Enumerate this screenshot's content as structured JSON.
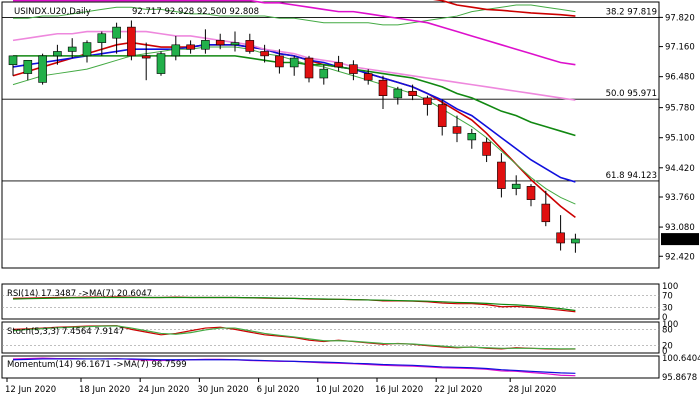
{
  "symbol_header": "USINDX.U20,Daily",
  "ohlc_header": "92.717 92.928 92.500 92.808",
  "colors": {
    "bull": "#22b04a",
    "bear": "#e01010",
    "wick": "#000000",
    "ma_red": "#cc0000",
    "ma_blue": "#1010dd",
    "ma_green": "#118811",
    "ma_thin_green": "#44aa44",
    "ma_magenta": "#dd10cc",
    "ma_pink": "#ee88dd",
    "fib_line": "#000000",
    "price_badge_bg": "#000000",
    "price_badge_fg": "#ffffff"
  },
  "chart_data": [
    {
      "type": "candlestick",
      "title": "USINDX.U20,Daily",
      "ylim": [
        92.2,
        98.1
      ],
      "price_ticks": [
        "97.820",
        "97.160",
        "96.480",
        "95.780",
        "95.100",
        "94.420",
        "93.760",
        "93.080",
        "92.420"
      ],
      "current_price": "92.808",
      "date_labels": [
        "12 Jun 2020",
        "18 Jun 2020",
        "24 Jun 2020",
        "30 Jun 2020",
        "6 Jul 2020",
        "10 Jul 2020",
        "16 Jul 2020",
        "22 Jul 2020",
        "28 Jul 2020"
      ],
      "fib_levels": [
        {
          "label": "38.2 97.819",
          "value": 97.819
        },
        {
          "label": "50.0 95.971",
          "value": 95.971
        },
        {
          "label": "61.8 94.123",
          "value": 94.123
        }
      ],
      "candles": [
        {
          "o": 96.75,
          "h": 96.95,
          "l": 96.5,
          "c": 96.95
        },
        {
          "o": 96.55,
          "h": 96.85,
          "l": 96.4,
          "c": 96.85
        },
        {
          "o": 96.35,
          "h": 97.0,
          "l": 96.3,
          "c": 96.95
        },
        {
          "o": 96.95,
          "h": 97.2,
          "l": 96.75,
          "c": 97.05
        },
        {
          "o": 97.05,
          "h": 97.35,
          "l": 96.9,
          "c": 97.15
        },
        {
          "o": 96.95,
          "h": 97.3,
          "l": 96.8,
          "c": 97.25
        },
        {
          "o": 97.25,
          "h": 97.5,
          "l": 96.95,
          "c": 97.45
        },
        {
          "o": 97.35,
          "h": 97.7,
          "l": 97.0,
          "c": 97.6
        },
        {
          "o": 97.6,
          "h": 97.75,
          "l": 96.85,
          "c": 96.95
        },
        {
          "o": 96.95,
          "h": 97.25,
          "l": 96.4,
          "c": 96.9
        },
        {
          "o": 96.55,
          "h": 97.05,
          "l": 96.5,
          "c": 97.0
        },
        {
          "o": 96.95,
          "h": 97.4,
          "l": 96.85,
          "c": 97.2
        },
        {
          "o": 97.2,
          "h": 97.3,
          "l": 97.0,
          "c": 97.1
        },
        {
          "o": 97.1,
          "h": 97.55,
          "l": 97.0,
          "c": 97.3
        },
        {
          "o": 97.3,
          "h": 97.45,
          "l": 97.1,
          "c": 97.2
        },
        {
          "o": 97.2,
          "h": 97.5,
          "l": 97.05,
          "c": 97.25
        },
        {
          "o": 97.3,
          "h": 97.45,
          "l": 97.0,
          "c": 97.05
        },
        {
          "o": 97.05,
          "h": 97.2,
          "l": 96.8,
          "c": 96.95
        },
        {
          "o": 96.95,
          "h": 97.1,
          "l": 96.55,
          "c": 96.7
        },
        {
          "o": 96.7,
          "h": 96.95,
          "l": 96.5,
          "c": 96.9
        },
        {
          "o": 96.9,
          "h": 96.95,
          "l": 96.35,
          "c": 96.45
        },
        {
          "o": 96.45,
          "h": 96.75,
          "l": 96.3,
          "c": 96.65
        },
        {
          "o": 96.8,
          "h": 96.95,
          "l": 96.6,
          "c": 96.7
        },
        {
          "o": 96.75,
          "h": 96.85,
          "l": 96.4,
          "c": 96.55
        },
        {
          "o": 96.55,
          "h": 96.65,
          "l": 96.3,
          "c": 96.4
        },
        {
          "o": 96.4,
          "h": 96.5,
          "l": 95.75,
          "c": 96.05
        },
        {
          "o": 96.0,
          "h": 96.25,
          "l": 95.85,
          "c": 96.2
        },
        {
          "o": 96.15,
          "h": 96.3,
          "l": 95.95,
          "c": 96.05
        },
        {
          "o": 96.0,
          "h": 96.05,
          "l": 95.6,
          "c": 95.85
        },
        {
          "o": 95.85,
          "h": 95.95,
          "l": 95.15,
          "c": 95.35
        },
        {
          "o": 95.35,
          "h": 95.6,
          "l": 95.0,
          "c": 95.2
        },
        {
          "o": 95.05,
          "h": 95.3,
          "l": 94.85,
          "c": 95.2
        },
        {
          "o": 95.0,
          "h": 95.1,
          "l": 94.55,
          "c": 94.7
        },
        {
          "o": 94.55,
          "h": 94.75,
          "l": 93.75,
          "c": 93.95
        },
        {
          "o": 93.95,
          "h": 94.25,
          "l": 93.8,
          "c": 94.05
        },
        {
          "o": 94.0,
          "h": 94.05,
          "l": 93.55,
          "c": 93.7
        },
        {
          "o": 93.6,
          "h": 93.9,
          "l": 93.1,
          "c": 93.2
        },
        {
          "o": 92.95,
          "h": 93.35,
          "l": 92.55,
          "c": 92.72
        },
        {
          "o": 92.72,
          "h": 92.93,
          "l": 92.5,
          "c": 92.81
        }
      ],
      "moving_averages": [
        {
          "color_key": "ma_red",
          "values": [
            96.5,
            96.6,
            96.7,
            96.8,
            96.9,
            97.0,
            97.1,
            97.2,
            97.25,
            97.2,
            97.15,
            97.15,
            97.15,
            97.2,
            97.2,
            97.2,
            97.15,
            97.1,
            97.0,
            96.95,
            96.85,
            96.75,
            96.7,
            96.65,
            96.55,
            96.45,
            96.35,
            96.25,
            96.1,
            95.9,
            95.7,
            95.5,
            95.2,
            94.85,
            94.5,
            94.15,
            93.85,
            93.55,
            93.3
          ]
        },
        {
          "color_key": "ma_blue",
          "values": [
            96.7,
            96.75,
            96.8,
            96.85,
            96.9,
            96.95,
            97.0,
            97.05,
            97.1,
            97.1,
            97.1,
            97.1,
            97.15,
            97.2,
            97.2,
            97.2,
            97.15,
            97.1,
            97.0,
            96.95,
            96.85,
            96.8,
            96.7,
            96.65,
            96.55,
            96.45,
            96.35,
            96.25,
            96.1,
            95.95,
            95.75,
            95.6,
            95.35,
            95.1,
            94.85,
            94.6,
            94.4,
            94.2,
            94.1
          ]
        },
        {
          "color_key": "ma_green",
          "values": [
            96.95,
            96.95,
            96.95,
            96.95,
            96.95,
            96.95,
            96.95,
            96.95,
            96.95,
            96.95,
            96.95,
            96.95,
            96.95,
            96.95,
            96.95,
            96.95,
            96.9,
            96.85,
            96.8,
            96.8,
            96.75,
            96.75,
            96.7,
            96.65,
            96.6,
            96.55,
            96.5,
            96.45,
            96.35,
            96.25,
            96.1,
            96.0,
            95.85,
            95.7,
            95.6,
            95.45,
            95.35,
            95.25,
            95.15
          ]
        },
        {
          "color_key": "ma_thin_green",
          "values": [
            96.3,
            96.4,
            96.5,
            96.55,
            96.6,
            96.65,
            96.75,
            96.85,
            96.95,
            97.0,
            97.05,
            97.1,
            97.1,
            97.15,
            97.15,
            97.15,
            97.1,
            97.0,
            96.95,
            96.85,
            96.75,
            96.7,
            96.6,
            96.5,
            96.4,
            96.3,
            96.2,
            96.1,
            95.95,
            95.75,
            95.55,
            95.35,
            95.1,
            94.8,
            94.5,
            94.2,
            93.95,
            93.75,
            93.6
          ]
        },
        {
          "color_key": "ma_thin_green",
          "values": [
            97.8,
            97.8,
            97.85,
            97.85,
            97.9,
            97.95,
            98.0,
            98.05,
            98.05,
            98.0,
            98.0,
            97.95,
            97.9,
            97.9,
            97.85,
            97.85,
            97.85,
            97.85,
            97.8,
            97.8,
            97.75,
            97.7,
            97.7,
            97.7,
            97.7,
            97.65,
            97.65,
            97.7,
            97.75,
            97.8,
            97.85,
            97.95,
            98.0,
            98.05,
            98.1,
            98.1,
            98.05,
            98.0,
            97.95
          ]
        },
        {
          "color_key": "ma_magenta",
          "values": [
            98.2,
            98.2,
            98.2,
            98.2,
            98.2,
            98.2,
            98.2,
            98.2,
            98.2,
            98.2,
            98.2,
            98.2,
            98.2,
            98.2,
            98.2,
            98.2,
            98.2,
            98.15,
            98.15,
            98.1,
            98.05,
            98.0,
            97.95,
            97.95,
            97.9,
            97.85,
            97.8,
            97.75,
            97.7,
            97.6,
            97.5,
            97.4,
            97.3,
            97.2,
            97.1,
            97.0,
            96.9,
            96.8,
            96.75
          ]
        },
        {
          "color_key": "ma_pink",
          "values": [
            97.3,
            97.35,
            97.4,
            97.45,
            97.45,
            97.5,
            97.5,
            97.5,
            97.5,
            97.5,
            97.45,
            97.4,
            97.4,
            97.35,
            97.3,
            97.25,
            97.2,
            97.1,
            97.05,
            97.0,
            96.9,
            96.85,
            96.8,
            96.7,
            96.65,
            96.6,
            96.55,
            96.5,
            96.45,
            96.4,
            96.35,
            96.3,
            96.25,
            96.2,
            96.15,
            96.1,
            96.05,
            96.0,
            95.95
          ]
        },
        {
          "color_key": "ma_red",
          "values": [
            98.3,
            98.3,
            98.3,
            98.3,
            98.3,
            98.3,
            98.3,
            98.3,
            98.3,
            98.3,
            98.3,
            98.3,
            98.3,
            98.3,
            98.3,
            98.3,
            98.3,
            98.3,
            98.3,
            98.3,
            98.3,
            98.3,
            98.3,
            98.3,
            98.3,
            98.3,
            98.3,
            98.3,
            98.25,
            98.2,
            98.1,
            98.05,
            98.0,
            97.98,
            97.95,
            97.92,
            97.9,
            97.88,
            97.85
          ]
        }
      ]
    },
    {
      "type": "line",
      "title": "RSI(14) 17.3487 ->MA(7) 20.6047",
      "yticks": [
        "100",
        "70",
        "30",
        "0"
      ],
      "series": [
        {
          "color_key": "ma_red",
          "values": [
            60,
            61,
            62,
            63,
            63,
            64,
            64,
            65,
            64,
            63,
            63,
            64,
            63,
            63,
            63,
            63,
            62,
            61,
            60,
            60,
            58,
            57,
            57,
            56,
            55,
            52,
            52,
            51,
            49,
            45,
            43,
            43,
            40,
            33,
            34,
            31,
            27,
            22,
            17
          ]
        },
        {
          "color_key": "ma_green",
          "values": [
            58,
            59,
            60,
            61,
            62,
            62,
            63,
            63,
            63,
            63,
            63,
            63,
            63,
            63,
            63,
            63,
            62,
            62,
            61,
            60,
            59,
            58,
            57,
            56,
            55,
            54,
            53,
            52,
            51,
            49,
            47,
            46,
            44,
            41,
            39,
            36,
            32,
            27,
            21
          ]
        }
      ]
    },
    {
      "type": "line",
      "title": "Stoch(5,3,3) 7.4564 7.9147",
      "yticks": [
        "100",
        "80",
        "20",
        "0"
      ],
      "series": [
        {
          "color_key": "ma_red",
          "values": [
            80,
            82,
            85,
            88,
            90,
            92,
            93,
            94,
            80,
            70,
            60,
            65,
            75,
            85,
            88,
            80,
            70,
            60,
            55,
            50,
            40,
            35,
            40,
            35,
            30,
            25,
            28,
            25,
            20,
            15,
            12,
            15,
            10,
            8,
            12,
            10,
            8,
            7,
            7.5
          ]
        },
        {
          "color_key": "ma_thin_green",
          "values": [
            75,
            80,
            83,
            86,
            88,
            90,
            92,
            93,
            85,
            75,
            65,
            62,
            68,
            78,
            85,
            85,
            75,
            65,
            58,
            52,
            45,
            38,
            38,
            36,
            32,
            28,
            27,
            26,
            22,
            18,
            14,
            14,
            12,
            10,
            10,
            10,
            9,
            8,
            7.9
          ]
        }
      ]
    },
    {
      "type": "line",
      "title": "Momentum(14) 96.1671 ->MA(7) 96.7599",
      "yticks": [
        "100.6404",
        "95.8678"
      ],
      "series": [
        {
          "color_key": "ma_magenta",
          "values": [
            100.4,
            100.5,
            100.6,
            100.5,
            100.5,
            100.4,
            100.4,
            100.5,
            100.3,
            100.1,
            100.0,
            100.1,
            100.2,
            100.3,
            100.3,
            100.2,
            100.0,
            99.9,
            99.8,
            99.8,
            99.6,
            99.4,
            99.3,
            99.2,
            99.0,
            98.8,
            98.7,
            98.6,
            98.4,
            98.2,
            98.1,
            98.0,
            97.8,
            97.4,
            97.3,
            97.0,
            96.7,
            96.3,
            96.2
          ]
        },
        {
          "color_key": "ma_blue",
          "values": [
            100.2,
            100.3,
            100.4,
            100.4,
            100.4,
            100.4,
            100.4,
            100.4,
            100.4,
            100.3,
            100.2,
            100.2,
            100.2,
            100.2,
            100.2,
            100.2,
            100.1,
            100.0,
            99.9,
            99.8,
            99.7,
            99.6,
            99.5,
            99.3,
            99.2,
            99.0,
            98.9,
            98.8,
            98.6,
            98.4,
            98.3,
            98.2,
            98.0,
            97.7,
            97.5,
            97.3,
            97.1,
            96.9,
            96.8
          ]
        }
      ]
    }
  ]
}
